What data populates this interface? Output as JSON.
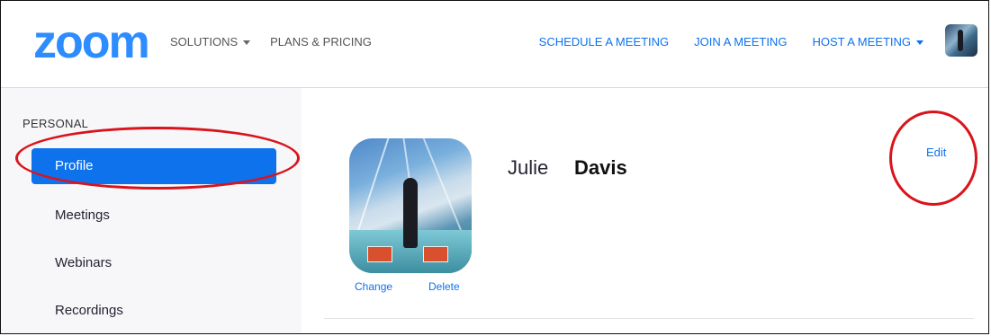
{
  "header": {
    "logo": "zoom",
    "nav_left": [
      {
        "label": "SOLUTIONS",
        "has_dropdown": true
      },
      {
        "label": "PLANS & PRICING",
        "has_dropdown": false
      }
    ],
    "nav_right": [
      {
        "label": "SCHEDULE A MEETING",
        "has_dropdown": false
      },
      {
        "label": "JOIN A MEETING",
        "has_dropdown": false
      },
      {
        "label": "HOST A MEETING",
        "has_dropdown": true
      }
    ]
  },
  "sidebar": {
    "section_label": "PERSONAL",
    "items": [
      {
        "label": "Profile",
        "active": true
      },
      {
        "label": "Meetings",
        "active": false
      },
      {
        "label": "Webinars",
        "active": false
      },
      {
        "label": "Recordings",
        "active": false
      }
    ]
  },
  "profile": {
    "first_name": "Julie",
    "last_name": "Davis",
    "photo_actions": {
      "change": "Change",
      "delete": "Delete"
    },
    "edit_label": "Edit"
  },
  "colors": {
    "brand": "#2d8cff",
    "link": "#0e72ed",
    "active_bg": "#0e72ed",
    "annotation_ring": "#d9141b"
  }
}
